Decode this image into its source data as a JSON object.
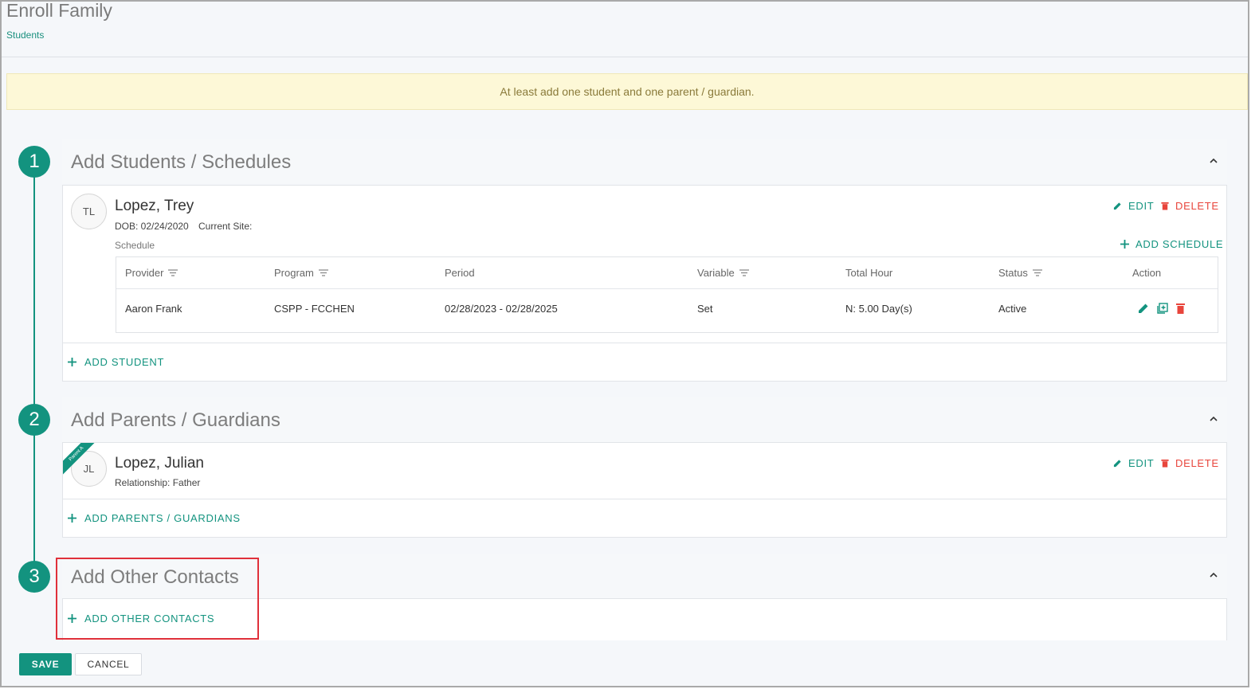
{
  "page": {
    "title": "Enroll Family",
    "breadcrumb": "Students",
    "alert": "At least add one student and one parent / guardian."
  },
  "steps": [
    {
      "number": "1",
      "title": "Add Students / Schedules"
    },
    {
      "number": "2",
      "title": "Add Parents / Guardians"
    },
    {
      "number": "3",
      "title": "Add Other Contacts"
    }
  ],
  "student": {
    "initials": "TL",
    "name": "Lopez, Trey",
    "dob": "DOB: 02/24/2020",
    "current_site": "Current Site:",
    "schedule_label": "Schedule",
    "edit_label": "EDIT",
    "delete_label": "DELETE",
    "add_schedule_label": "ADD SCHEDULE"
  },
  "schedule_table": {
    "headers": [
      "Provider",
      "Program",
      "Period",
      "Variable",
      "Total Hour",
      "Status",
      "Action"
    ],
    "rows": [
      {
        "provider": "Aaron Frank",
        "program": "CSPP - FCCHEN",
        "period": "02/28/2023 - 02/28/2025",
        "variable": "Set",
        "total_hour": "N: 5.00 Day(s)",
        "status": "Active"
      }
    ]
  },
  "add_student_label": "ADD STUDENT",
  "parent": {
    "initials": "JL",
    "ribbon": "Parent A",
    "name": "Lopez, Julian",
    "relationship": "Relationship: Father",
    "edit_label": "EDIT",
    "delete_label": "DELETE"
  },
  "add_parent_label": "ADD PARENTS / GUARDIANS",
  "add_contact_label": "ADD OTHER CONTACTS",
  "footer": {
    "save_label": "SAVE",
    "cancel_label": "CANCEL"
  },
  "colors": {
    "accent": "#13937f",
    "danger": "#e8453c",
    "alert_bg": "#fdf8d7",
    "highlight": "#e0303a"
  }
}
